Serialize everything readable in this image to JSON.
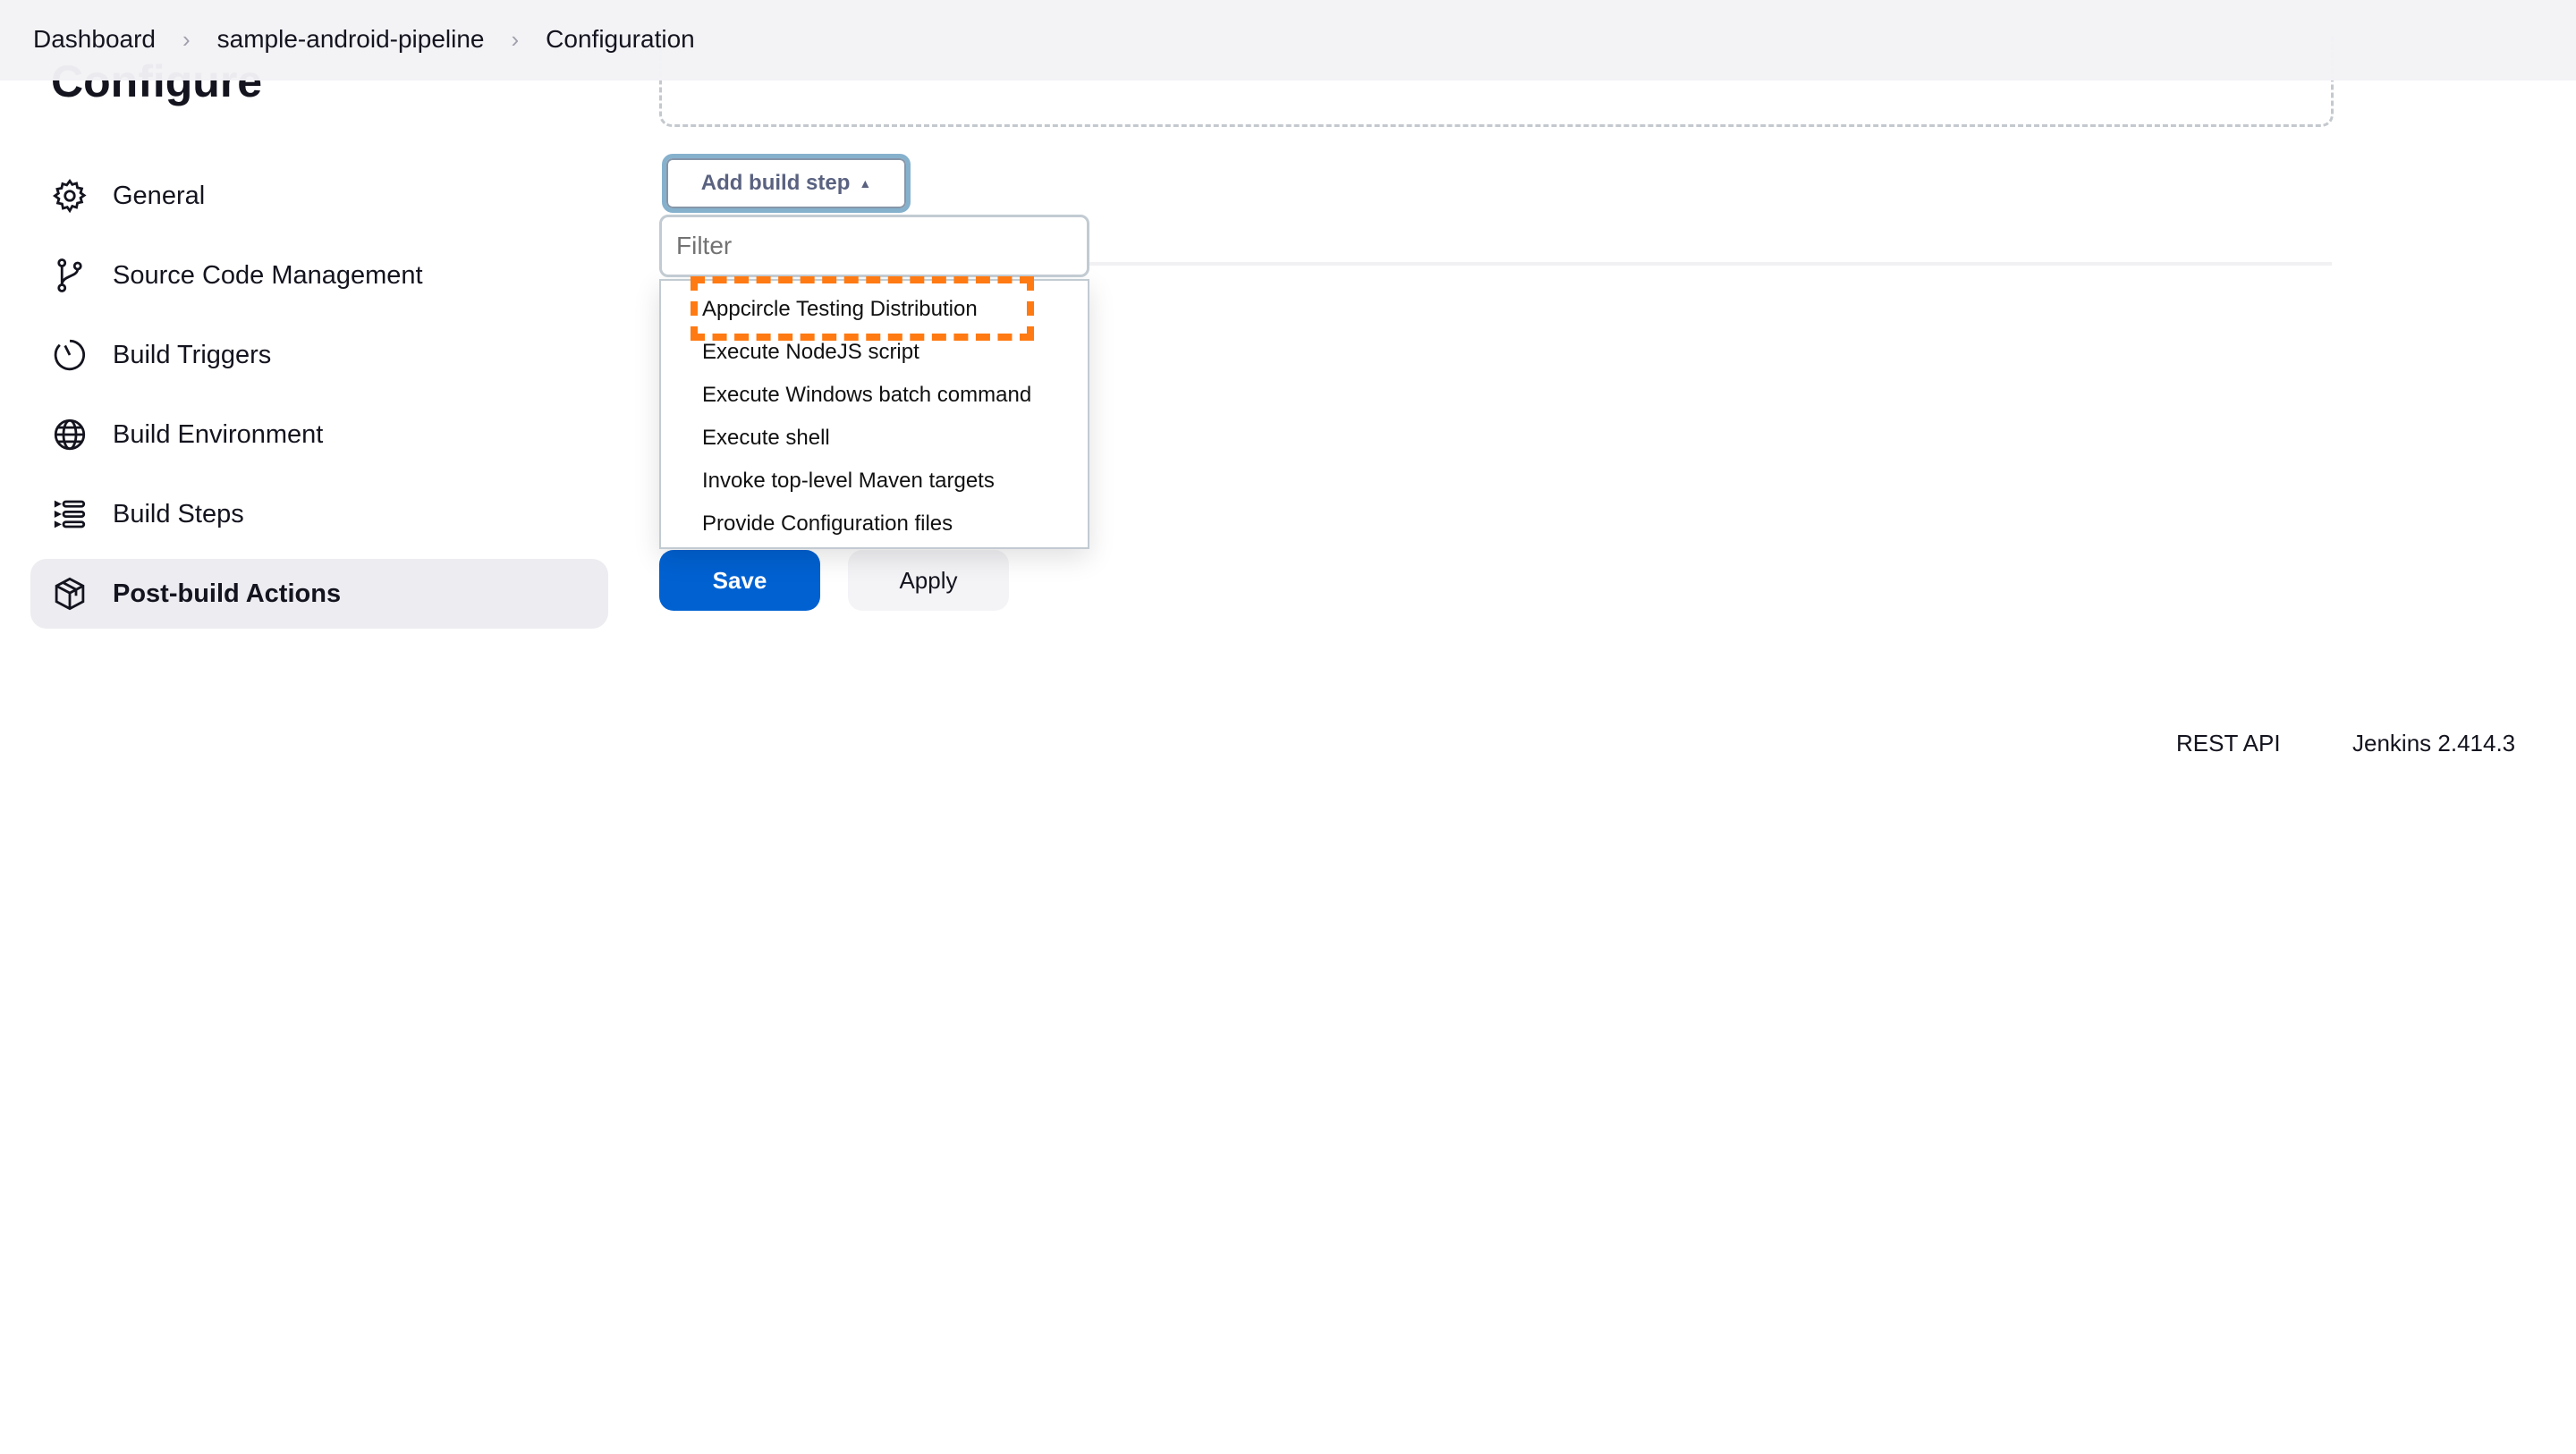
{
  "breadcrumb": [
    "Dashboard",
    "sample-android-pipeline",
    "Configuration"
  ],
  "page_title": "Configure",
  "sidebar": {
    "items": [
      {
        "label": "General",
        "icon": "gear-icon"
      },
      {
        "label": "Source Code Management",
        "icon": "git-branch-icon"
      },
      {
        "label": "Build Triggers",
        "icon": "timer-icon"
      },
      {
        "label": "Build Environment",
        "icon": "globe-icon"
      },
      {
        "label": "Build Steps",
        "icon": "list-steps-icon"
      },
      {
        "label": "Post-build Actions",
        "icon": "package-icon",
        "active": true
      }
    ]
  },
  "build_steps": {
    "add_button_label": "Add build step",
    "filter_placeholder": "Filter",
    "filter_value": "",
    "options": [
      "Appcircle Testing Distribution",
      "Execute NodeJS script",
      "Execute Windows batch command",
      "Execute shell",
      "Invoke top-level Maven targets",
      "Provide Configuration files"
    ],
    "highlighted_option": "Appcircle Testing Distribution",
    "highlight_color": "#ff7a12"
  },
  "actions": {
    "save_label": "Save",
    "apply_label": "Apply",
    "save_color": "#0161d1"
  },
  "footer": {
    "rest_api": "REST API",
    "version": "Jenkins 2.414.3"
  }
}
